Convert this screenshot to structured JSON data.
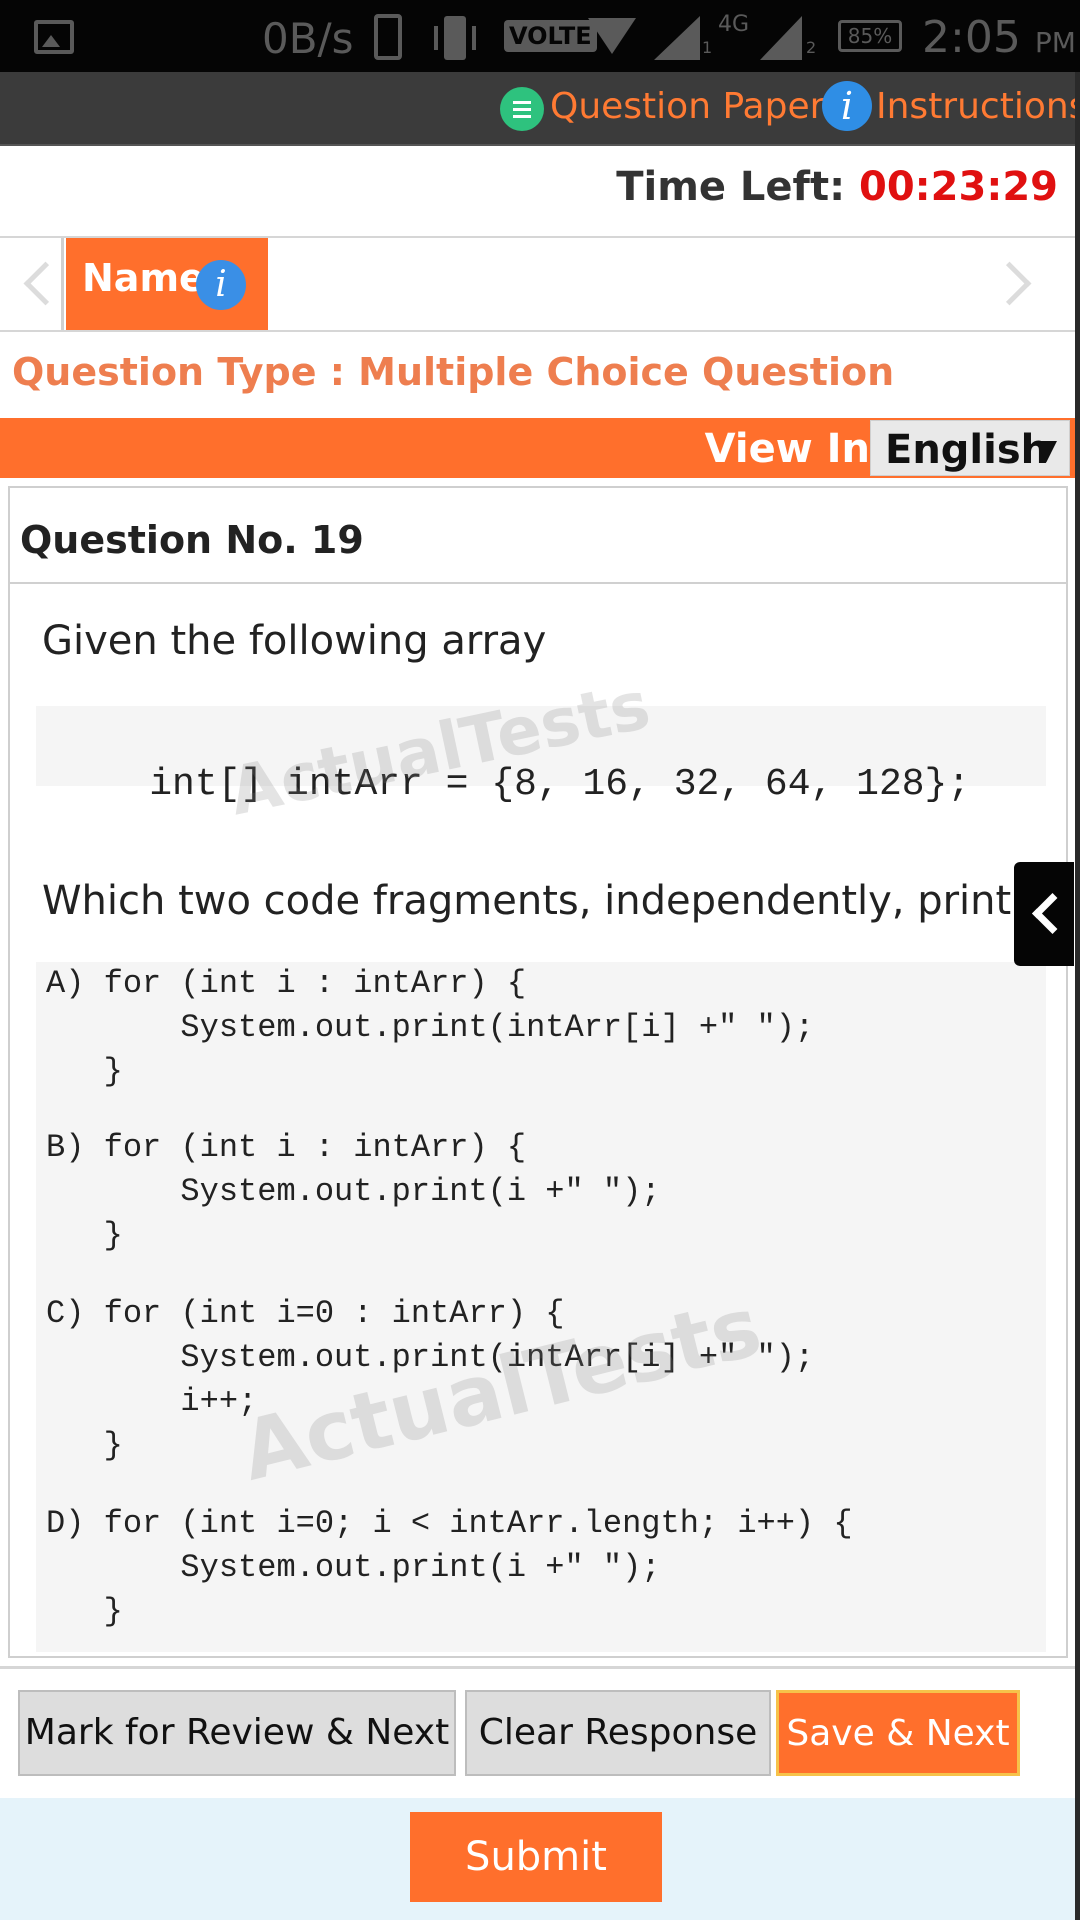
{
  "status_bar": {
    "net_speed": "0B/s",
    "volte": "VOLTE",
    "network": "4G",
    "sim1": "1",
    "sim2": "2",
    "battery": "85%",
    "time": "2:05",
    "ampm": "PM"
  },
  "header": {
    "question_paper_label": "Question Paper",
    "instructions_label": "Instructions"
  },
  "timer": {
    "label": "Time Left:",
    "value": "00:23:29"
  },
  "section_tab": {
    "label": "Name",
    "info_glyph": "i"
  },
  "question_type": "Question Type : Multiple Choice Question",
  "view_in": {
    "label": "View In",
    "selected_language": "English",
    "caret": "▼"
  },
  "question": {
    "number_label": "Question No. 19",
    "intro": "Given the following array",
    "array_code": "int[] intArr = {8, 16, 32, 64, 128};",
    "prompt": "Which two code fragments, independently, print each",
    "watermark_text": "ActualTests",
    "options": [
      {
        "code": "A) for (int i : intArr) {\n       System.out.print(intArr[i] +\" \");\n   }"
      },
      {
        "code": "B) for (int i : intArr) {\n       System.out.print(i +\" \");\n   }"
      },
      {
        "code": "C) for (int i=0 : intArr) {\n       System.out.print(intArr[i] +\" \");\n       i++;\n   }"
      },
      {
        "code": "D) for (int i=0; i < intArr.length; i++) {\n       System.out.print(i +\" \");\n   }"
      }
    ]
  },
  "actions": {
    "mark_review_next": "Mark for Review & Next",
    "clear_response": "Clear Response",
    "save_next": "Save & Next",
    "submit": "Submit"
  },
  "colors": {
    "accent_orange": "#ff6f2c",
    "timer_red": "#e01010",
    "question_type_text": "#ee7e4f",
    "info_blue": "#2f8ee5",
    "paper_green": "#2ec27e"
  },
  "icons": {
    "gallery": "image-icon",
    "phone": "phone-icon",
    "vibrate": "vibrate-icon",
    "wifi": "wifi-icon",
    "signal": "signal-icon",
    "battery": "battery-icon",
    "question_paper": "list-icon",
    "instructions": "info-icon",
    "side_toggle": "chevron-left-icon"
  }
}
